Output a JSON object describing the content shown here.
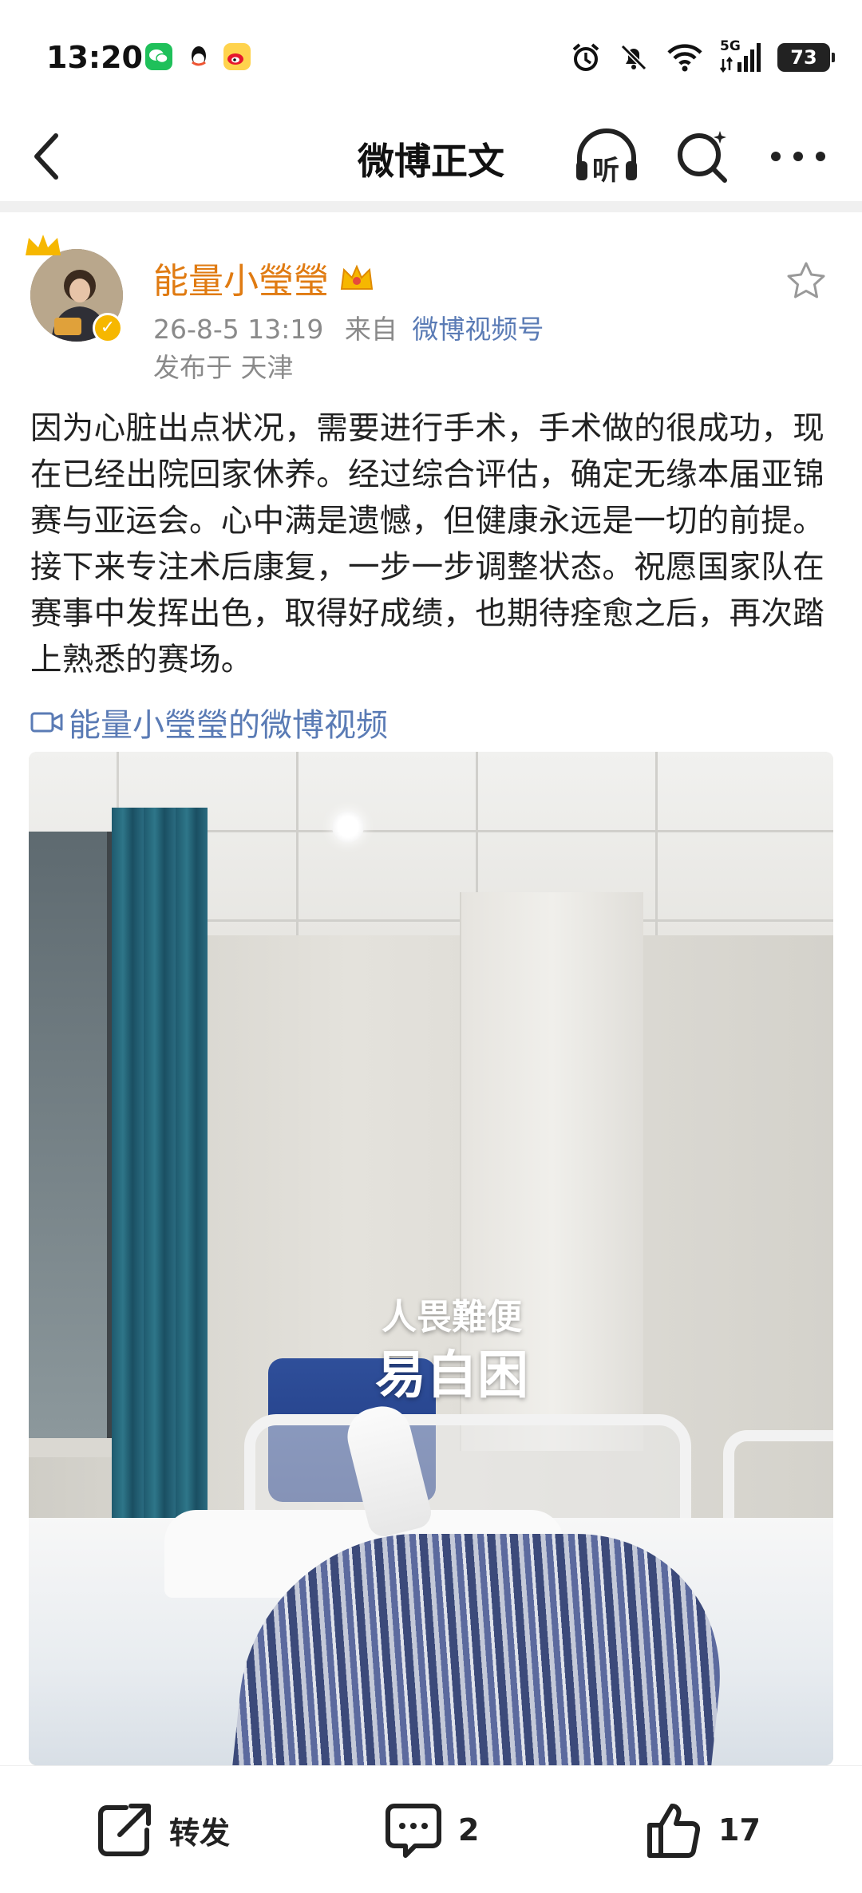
{
  "status_bar": {
    "time": "13:20",
    "network": "5G",
    "battery": "73",
    "app_icons": [
      "wechat-icon",
      "qq-icon",
      "weibo-icon"
    ],
    "status_icons": [
      "alarm-icon",
      "mute-icon",
      "wifi-icon",
      "signal-icon"
    ]
  },
  "nav": {
    "title": "微博正文",
    "listen_icon_text": "听"
  },
  "post": {
    "author": "能量小瑩瑩",
    "date": "26-8-5 13:19",
    "source_prefix": "来自",
    "source": "微博视频号",
    "location": "发布于 天津",
    "text": "因为心脏出点状况，需要进行手术，手术做的很成功，现在已经出院回家休养。经过综合评估，确定无缘本届亚锦赛与亚运会。心中满是遗憾，但健康永远是一切的前提。接下来专注术后康复，一步一步调整状态。祝愿国家队在赛事中发挥出色，取得好成绩，也期待痊愈之后，再次踏上熟悉的赛场。",
    "video_link": "能量小瑩瑩的微博视频",
    "video_overlay_line1": "人畏難便",
    "video_overlay_line2": "易自困"
  },
  "actions": {
    "repost_label": "转发",
    "comment_count": "2",
    "like_count": "17"
  },
  "colors": {
    "username": "#e07b12",
    "link": "#5a7bb5",
    "verified_badge": "#f6b700"
  }
}
